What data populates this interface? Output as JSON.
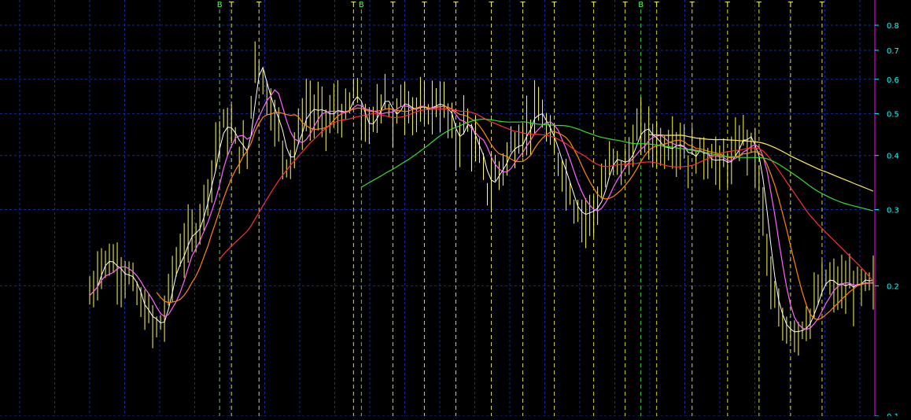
{
  "chart_data": {
    "type": "line",
    "y_scale": "log",
    "ylim": [
      0.1,
      0.87
    ],
    "y_ticks": [
      {
        "value": 0.8,
        "label": "0.8"
      },
      {
        "value": 0.7,
        "label": "0.7"
      },
      {
        "value": 0.6,
        "label": "0.6"
      },
      {
        "value": 0.5,
        "label": "0.5"
      },
      {
        "value": 0.4,
        "label": "0.4"
      },
      {
        "value": 0.3,
        "label": "0.3"
      },
      {
        "value": 0.2,
        "label": "0.2"
      },
      {
        "value": 0.1,
        "label": "0.1"
      }
    ],
    "x_count": 200,
    "grid": true,
    "colors": {
      "background": "#000000",
      "grid": "#1a2a8a",
      "price": "#ffff55",
      "close_line": "#ffffff",
      "signal_B": "#55ff55",
      "signal_T": "#ffff55",
      "axis": "#ff00ff",
      "axis_labels": "#00ffff",
      "ma_short": "#ffffff",
      "ma_medium": "#ff66ff",
      "ma_orange": "#ff8800",
      "ma_red": "#ff3030",
      "ma_green": "#33dd33",
      "ma_yellow": "#ffee55"
    },
    "signals": [
      {
        "label": "B",
        "x": 33
      },
      {
        "label": "T",
        "x": 36
      },
      {
        "label": "T",
        "x": 43
      },
      {
        "label": "T",
        "x": 67
      },
      {
        "label": "B",
        "x": 69
      },
      {
        "label": "T",
        "x": 77
      },
      {
        "label": "T",
        "x": 85
      },
      {
        "label": "T",
        "x": 93
      },
      {
        "label": "T",
        "x": 102
      },
      {
        "label": "T",
        "x": 110
      },
      {
        "label": "T",
        "x": 118
      },
      {
        "label": "T",
        "x": 128
      },
      {
        "label": "T",
        "x": 136
      },
      {
        "label": "B",
        "x": 140
      },
      {
        "label": "T",
        "x": 144
      },
      {
        "label": "T",
        "x": 153
      },
      {
        "label": "T",
        "x": 162
      },
      {
        "label": "T",
        "x": 170
      },
      {
        "label": "T",
        "x": 178
      },
      {
        "label": "T",
        "x": 186
      }
    ],
    "price_keypoints": [
      [
        0,
        0.19
      ],
      [
        3,
        0.23
      ],
      [
        7,
        0.225
      ],
      [
        10,
        0.21
      ],
      [
        13,
        0.18
      ],
      [
        17,
        0.16
      ],
      [
        19,
        0.17
      ],
      [
        21,
        0.215
      ],
      [
        24,
        0.25
      ],
      [
        27,
        0.27
      ],
      [
        30,
        0.34
      ],
      [
        33,
        0.46
      ],
      [
        35,
        0.47
      ],
      [
        37,
        0.43
      ],
      [
        40,
        0.4
      ],
      [
        42,
        0.7
      ],
      [
        44,
        0.6
      ],
      [
        47,
        0.49
      ],
      [
        50,
        0.39
      ],
      [
        52,
        0.42
      ],
      [
        55,
        0.52
      ],
      [
        58,
        0.5
      ],
      [
        61,
        0.49
      ],
      [
        63,
        0.52
      ],
      [
        65,
        0.49
      ],
      [
        67,
        0.56
      ],
      [
        69,
        0.5
      ],
      [
        71,
        0.45
      ],
      [
        73,
        0.51
      ],
      [
        75,
        0.58
      ],
      [
        77,
        0.46
      ],
      [
        79,
        0.55
      ],
      [
        82,
        0.52
      ],
      [
        85,
        0.5
      ],
      [
        88,
        0.54
      ],
      [
        91,
        0.5
      ],
      [
        93,
        0.42
      ],
      [
        95,
        0.49
      ],
      [
        97,
        0.45
      ],
      [
        99,
        0.39
      ],
      [
        101,
        0.34
      ],
      [
        104,
        0.37
      ],
      [
        107,
        0.42
      ],
      [
        110,
        0.45
      ],
      [
        113,
        0.5
      ],
      [
        115,
        0.49
      ],
      [
        117,
        0.43
      ],
      [
        120,
        0.38
      ],
      [
        123,
        0.31
      ],
      [
        126,
        0.29
      ],
      [
        129,
        0.31
      ],
      [
        131,
        0.36
      ],
      [
        133,
        0.39
      ],
      [
        136,
        0.38
      ],
      [
        138,
        0.43
      ],
      [
        140,
        0.46
      ],
      [
        143,
        0.44
      ],
      [
        146,
        0.42
      ],
      [
        148,
        0.44
      ],
      [
        150,
        0.43
      ],
      [
        152,
        0.4
      ],
      [
        155,
        0.41
      ],
      [
        158,
        0.4
      ],
      [
        160,
        0.38
      ],
      [
        163,
        0.39
      ],
      [
        166,
        0.45
      ],
      [
        169,
        0.41
      ],
      [
        171,
        0.3
      ],
      [
        173,
        0.2
      ],
      [
        175,
        0.165
      ],
      [
        178,
        0.16
      ],
      [
        180,
        0.16
      ],
      [
        183,
        0.17
      ],
      [
        185,
        0.19
      ],
      [
        187,
        0.21
      ],
      [
        188,
        0.2
      ]
    ],
    "moving_averages": [
      {
        "key": "ma_short",
        "period": 3,
        "start": 0
      },
      {
        "key": "ma_medium",
        "period": 7,
        "start": 0
      },
      {
        "key": "ma_orange",
        "period": 12,
        "start": 17
      },
      {
        "key": "ma_red",
        "period": 32,
        "start": 33
      },
      {
        "key": "ma_green",
        "period": 70,
        "start": 69
      },
      {
        "key": "ma_yellow",
        "period": 110,
        "start": 142
      }
    ]
  }
}
